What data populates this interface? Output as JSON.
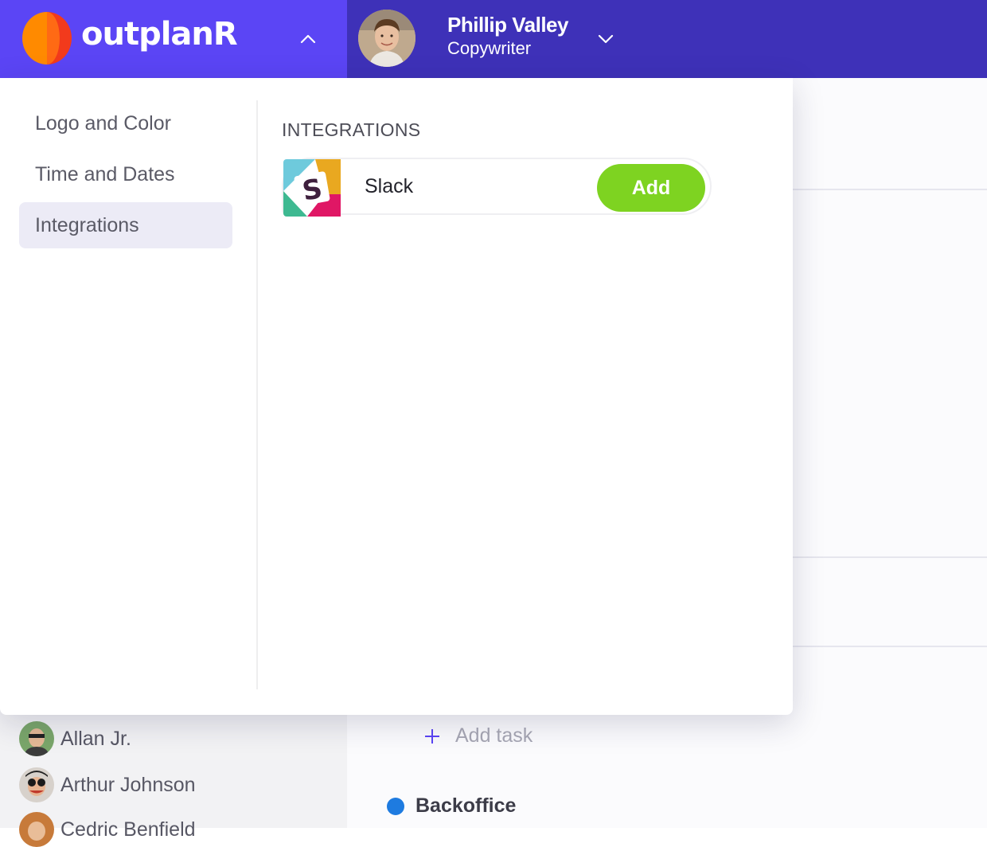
{
  "header": {
    "brand_name": "outplanR",
    "user": {
      "name": "Phillip Valley",
      "role": "Copywriter"
    }
  },
  "settings_nav": {
    "items": [
      {
        "label": "Logo and Color",
        "active": false
      },
      {
        "label": "Time and Dates",
        "active": false
      },
      {
        "label": "Integrations",
        "active": true
      }
    ]
  },
  "integrations": {
    "section_title": "INTEGRATIONS",
    "items": [
      {
        "name": "Slack",
        "action_label": "Add"
      }
    ]
  },
  "background": {
    "people": [
      {
        "name": "Allan Jr."
      },
      {
        "name": "Arthur Johnson"
      },
      {
        "name": "Cedric Benfield"
      }
    ],
    "add_task_label": "Add task",
    "project": {
      "name": "Backoffice"
    }
  },
  "colors": {
    "brand_bar": "#5b45f5",
    "user_bar": "#3e31b8",
    "add_button": "#7ed321",
    "active_nav": "#ecebf6",
    "project_dot": "#1e7be0"
  },
  "icons": {
    "brand_logo": "outplanr-logo-icon",
    "brand_toggle": "chevron-up-icon",
    "user_menu_toggle": "chevron-down-icon",
    "integration_logo": "slack-logo-icon",
    "add_task": "plus-icon"
  }
}
